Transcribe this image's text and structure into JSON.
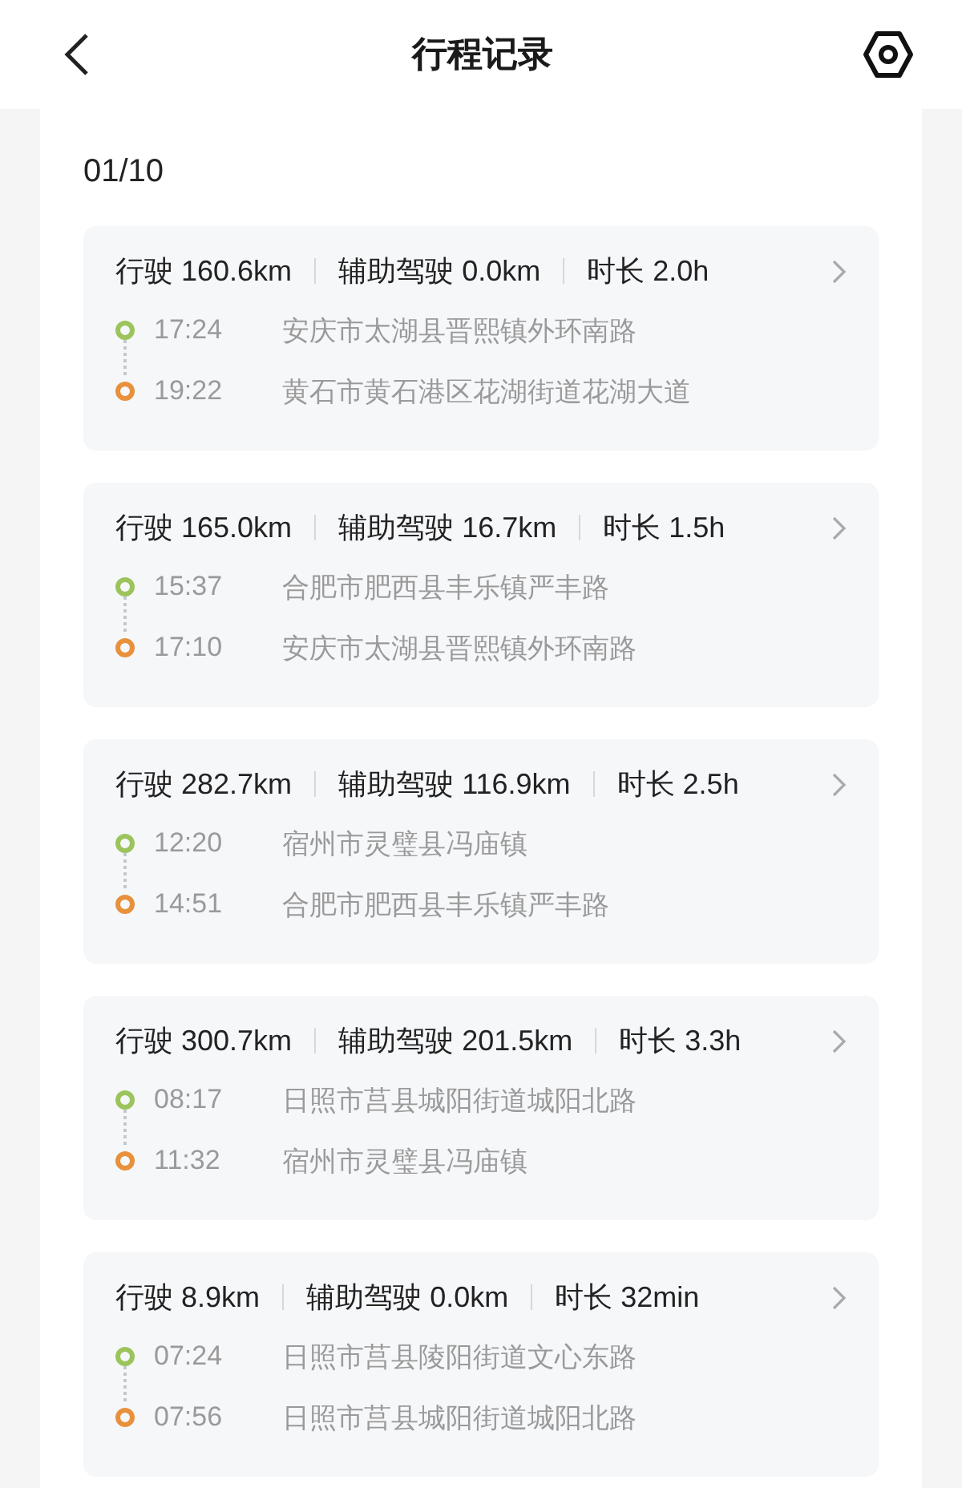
{
  "header": {
    "title": "行程记录"
  },
  "date": "01/10",
  "trips": [
    {
      "stats": [
        {
          "label": "行驶",
          "value": "160.6km"
        },
        {
          "label": "辅助驾驶",
          "value": "0.0km"
        },
        {
          "label": "时长",
          "value": "2.0h"
        }
      ],
      "stops": [
        {
          "color": "#9cc45c",
          "time": "17:24",
          "place": "安庆市太湖县晋熙镇外环南路"
        },
        {
          "color": "#e8913c",
          "time": "19:22",
          "place": "黄石市黄石港区花湖街道花湖大道"
        }
      ]
    },
    {
      "stats": [
        {
          "label": "行驶",
          "value": "165.0km"
        },
        {
          "label": "辅助驾驶",
          "value": "16.7km"
        },
        {
          "label": "时长",
          "value": "1.5h"
        }
      ],
      "stops": [
        {
          "color": "#9cc45c",
          "time": "15:37",
          "place": "合肥市肥西县丰乐镇严丰路"
        },
        {
          "color": "#e8913c",
          "time": "17:10",
          "place": "安庆市太湖县晋熙镇外环南路"
        }
      ]
    },
    {
      "stats": [
        {
          "label": "行驶",
          "value": "282.7km"
        },
        {
          "label": "辅助驾驶",
          "value": "116.9km"
        },
        {
          "label": "时长",
          "value": "2.5h"
        }
      ],
      "stops": [
        {
          "color": "#9cc45c",
          "time": "12:20",
          "place": "宿州市灵璧县冯庙镇"
        },
        {
          "color": "#e8913c",
          "time": "14:51",
          "place": "合肥市肥西县丰乐镇严丰路"
        }
      ]
    },
    {
      "stats": [
        {
          "label": "行驶",
          "value": "300.7km"
        },
        {
          "label": "辅助驾驶",
          "value": "201.5km"
        },
        {
          "label": "时长",
          "value": "3.3h"
        }
      ],
      "stops": [
        {
          "color": "#9cc45c",
          "time": "08:17",
          "place": "日照市莒县城阳街道城阳北路"
        },
        {
          "color": "#e8913c",
          "time": "11:32",
          "place": "宿州市灵璧县冯庙镇"
        }
      ]
    },
    {
      "stats": [
        {
          "label": "行驶",
          "value": "8.9km"
        },
        {
          "label": "辅助驾驶",
          "value": "0.0km"
        },
        {
          "label": "时长",
          "value": "32min"
        }
      ],
      "stops": [
        {
          "color": "#9cc45c",
          "time": "07:24",
          "place": "日照市莒县陵阳街道文心东路"
        },
        {
          "color": "#e8913c",
          "time": "07:56",
          "place": "日照市莒县城阳街道城阳北路"
        }
      ]
    }
  ]
}
